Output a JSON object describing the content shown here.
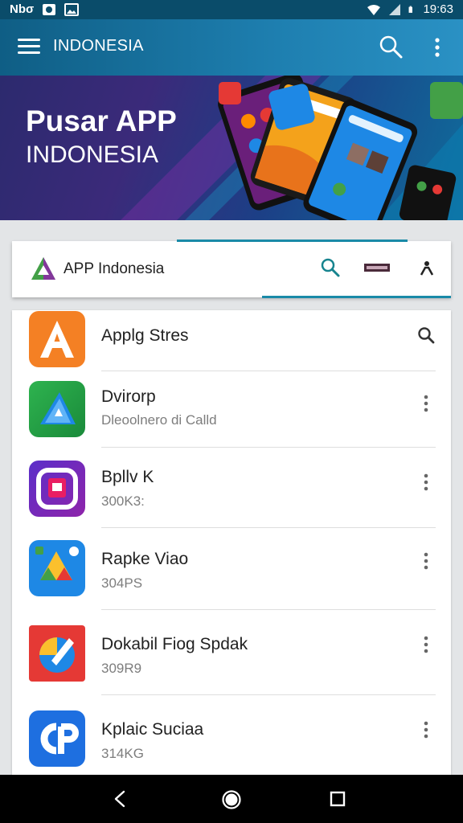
{
  "status_bar": {
    "carrier": "Nbσ",
    "time": "19:63",
    "icons": [
      "photo-icon",
      "image-icon",
      "wifi-icon",
      "signal-icon",
      "battery-icon"
    ]
  },
  "app_bar": {
    "title": "INDONESIA",
    "icons": [
      "menu-icon",
      "search-icon",
      "more-vert-icon"
    ]
  },
  "hero": {
    "title": "Pusar APP",
    "subtitle": "INDONESIA"
  },
  "toolbar_card": {
    "title": "APP Indonesia",
    "icons": [
      "app-logo-icon",
      "search-icon",
      "bar-icon",
      "person-icon"
    ],
    "accent": "#1a8aa8"
  },
  "app_list": {
    "items": [
      {
        "name": "Applg Stres",
        "sub": "",
        "icon": "letter-a-app-icon",
        "action": "search-icon"
      },
      {
        "name": "Dvirorp",
        "sub": "Dleoolnero di Calld",
        "icon": "triangle-app-icon",
        "action": "more-vert-icon"
      },
      {
        "name": "Bpllv K",
        "sub": "300K3:",
        "icon": "camera-app-icon",
        "action": "more-vert-icon"
      },
      {
        "name": "Rapke Viao",
        "sub": "304PS",
        "icon": "drive-app-icon",
        "action": "more-vert-icon"
      },
      {
        "name": "Dokabil Fiog Spdak",
        "sub": "309R9",
        "icon": "pen-app-icon",
        "action": "more-vert-icon"
      },
      {
        "name": "Kplaic Suciaa",
        "sub": "314KG",
        "icon": "cp-app-icon",
        "action": "more-vert-icon"
      }
    ]
  },
  "nav_bar": {
    "icons": [
      "back-icon",
      "home-icon",
      "recents-icon"
    ]
  }
}
